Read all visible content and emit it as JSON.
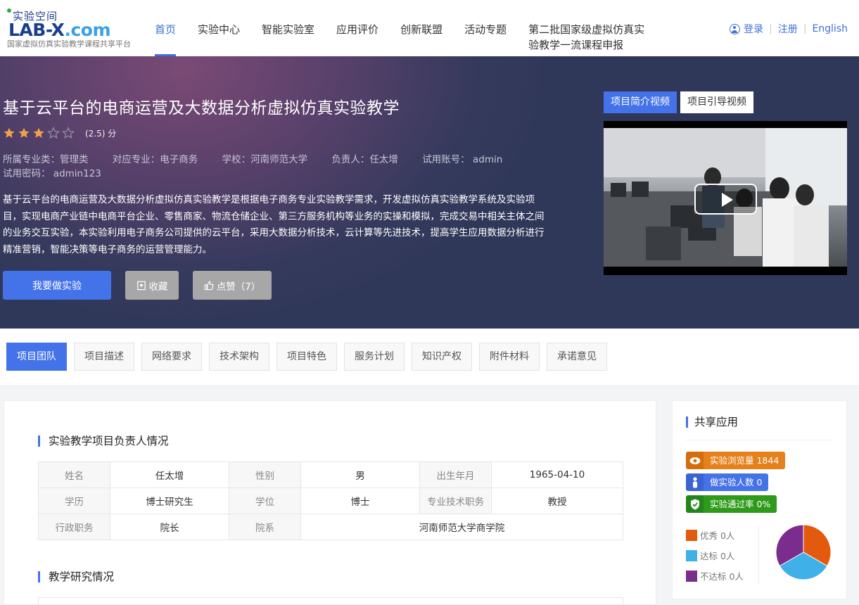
{
  "logo": {
    "cn": "实验空间",
    "en_main": "LAB-X",
    "en_dot": ".com",
    "tagline": "国家虚拟仿真实验教学课程共享平台"
  },
  "nav": {
    "items": [
      {
        "label": "首页"
      },
      {
        "label": "实验中心"
      },
      {
        "label": "智能实验室"
      },
      {
        "label": "应用评价"
      },
      {
        "label": "创新联盟"
      },
      {
        "label": "活动专题"
      },
      {
        "label": "第二批国家级虚拟仿真实验教学一流课程申报"
      }
    ],
    "login": "登录",
    "register": "注册",
    "english": "English"
  },
  "hero": {
    "title": "基于云平台的电商运营及大数据分析虚拟仿真实验教学",
    "rating_value": 2.5,
    "rating_max": 5,
    "rating_text": "(2.5) 分",
    "meta": [
      "所属专业类：管理类",
      "对应专业：电子商务",
      "学校：河南师范大学",
      "负责人：任太增",
      "试用账号：  admin",
      "试用密码：  admin123"
    ],
    "description": "基于云平台的电商运营及大数据分析虚拟仿真实验教学是根据电子商务专业实验教学需求，开发虚拟仿真实验教学系统及实验项目，实现电商产业链中电商平台企业、零售商家、物流仓储企业、第三方服务机构等业务的实操和模拟，完成交易中相关主体之间的业务交互实验，本实验利用电子商务公司提供的云平台，采用大数据分析技术，云计算等先进技术，提高学生应用数据分析进行精准营销，智能决策等电子商务的运营管理能力。",
    "btn_start": "我要做实验",
    "btn_favorite": "收藏",
    "btn_like": "点赞（7）",
    "video_tab_intro": "项目简介视频",
    "video_tab_guide": "项目引导视频"
  },
  "tabs": [
    "项目团队",
    "项目描述",
    "网络要求",
    "技术架构",
    "项目特色",
    "服务计划",
    "知识产权",
    "附件材料",
    "承诺意见"
  ],
  "team": {
    "title": "实验教学项目负责人情况",
    "rows": [
      [
        {
          "k": "姓名",
          "v": "任太增"
        },
        {
          "k": "性别",
          "v": "男"
        },
        {
          "k": "出生年月",
          "v": "1965-04-10"
        }
      ],
      [
        {
          "k": "学历",
          "v": "博士研究生"
        },
        {
          "k": "学位",
          "v": "博士"
        },
        {
          "k": "专业技术职务",
          "v": "教授"
        }
      ],
      [
        {
          "k": "行政职务",
          "v": "院长"
        },
        {
          "k": "院系",
          "v": "河南师范大学商学院"
        }
      ]
    ],
    "research_title": "教学研究情况"
  },
  "share": {
    "title": "共享应用",
    "views": "实验浏览量 1844",
    "users": "做实验人数 0",
    "pass": "实验通过率 0%",
    "legend": [
      {
        "label": "优秀 0人",
        "color": "#e35a0e"
      },
      {
        "label": "达标 0人",
        "color": "#3fb0e8"
      },
      {
        "label": "不达标 0人",
        "color": "#7b2d8e"
      }
    ],
    "colors": {
      "views": "#e6801a",
      "users": "#4472e8",
      "pass": "#2e9a1a"
    }
  }
}
